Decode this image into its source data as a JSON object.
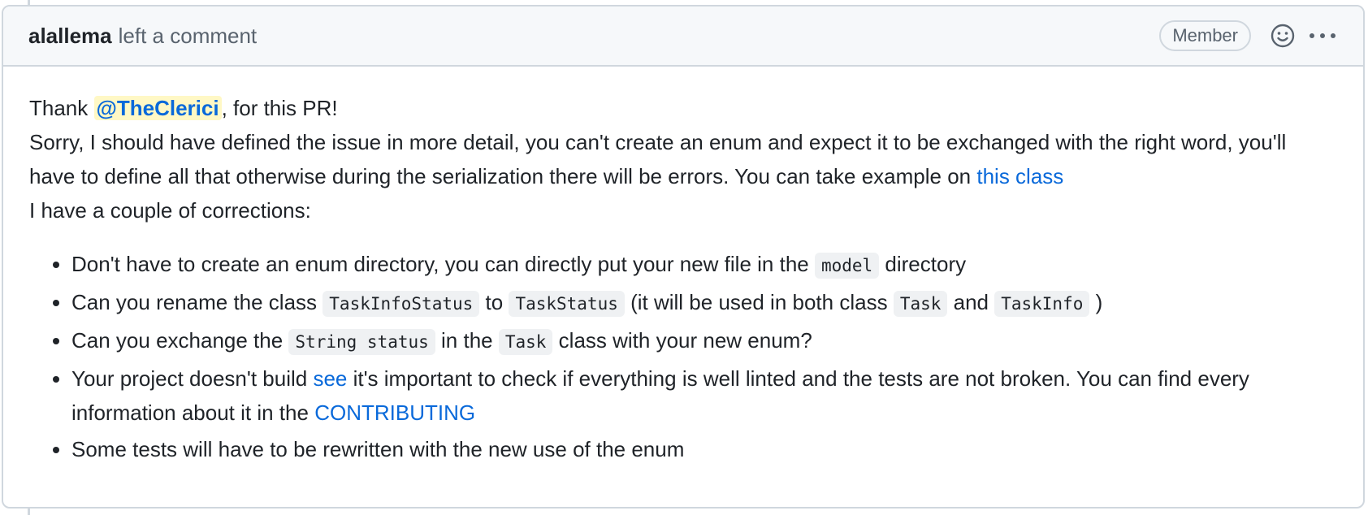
{
  "comment": {
    "author": "alallema",
    "action": "left a comment",
    "badge": "Member",
    "body": {
      "greeting_prefix": "Thank ",
      "mention": "@TheClerici",
      "greeting_suffix": ", for this PR!",
      "paragraph_text": "Sorry, I should have defined the issue in more detail, you can't create an enum and expect it to be exchanged with the right word, you'll have to define all that otherwise during the serialization there will be errors. You can take example on ",
      "paragraph_link": "this class",
      "corrections_intro": "I have a couple of corrections:",
      "items": [
        {
          "t1": "Don't have to create an enum directory, you can directly put your new file in the ",
          "c1": "model",
          "t2": " directory"
        },
        {
          "t1": "Can you rename the class ",
          "c1": "TaskInfoStatus",
          "t2": " to ",
          "c2": "TaskStatus",
          "t3": " (it will be used in both class ",
          "c3": "Task",
          "t4": " and ",
          "c4": "TaskInfo",
          "t5": " )"
        },
        {
          "t1": "Can you exchange the ",
          "c1": "String status",
          "t2": " in the ",
          "c2": "Task",
          "t3": " class with your new enum?"
        },
        {
          "t1": "Your project doesn't build ",
          "l1": "see",
          "t2": " it's important to check if everything is well linted and the tests are not broken. You can find every information about it in the ",
          "l2": "CONTRIBUTING"
        },
        {
          "t1": "Some tests will have to be rewritten with the new use of the enum"
        }
      ]
    }
  },
  "icons": {
    "emoji": "smiley-icon",
    "more": "kebab-horizontal-icon"
  },
  "colors": {
    "link": "#0969da",
    "mention_bg": "#fff8c5",
    "header_bg": "#f6f8fa",
    "border": "#d0d7de",
    "muted_text": "#59636e",
    "code_bg": "#eff1f3"
  }
}
